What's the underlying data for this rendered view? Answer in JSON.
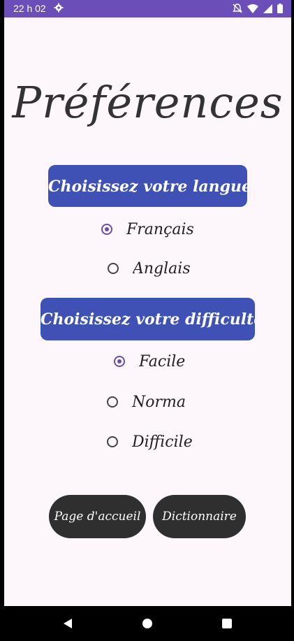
{
  "status_bar": {
    "time": "22 h 02",
    "icons": [
      "gear-icon",
      "mute-icon",
      "wifi-icon",
      "signal-icon",
      "battery-icon"
    ]
  },
  "title": "Préférences",
  "language_section": {
    "header": "Choisissez votre langue:",
    "options": [
      {
        "label": "Français",
        "checked": true
      },
      {
        "label": "Anglais",
        "checked": false
      }
    ]
  },
  "difficulty_section": {
    "header": "Choisissez votre difficulté:",
    "options": [
      {
        "label": "Facile",
        "checked": true
      },
      {
        "label": "Normal",
        "checked": false
      },
      {
        "label": "Difficile",
        "checked": false
      }
    ]
  },
  "buttons": {
    "home": "Page d'accueil",
    "dictionary": "Dictionnaire"
  },
  "nav_bar": {
    "icons": [
      "back-icon",
      "home-icon",
      "recents-icon"
    ]
  },
  "colors": {
    "status_bar": "#6b4eb8",
    "header_bg": "#3f51b5",
    "radio_checked": "#6750a4",
    "button_bg": "#2f2f2f",
    "background": "#fdf6fb"
  }
}
